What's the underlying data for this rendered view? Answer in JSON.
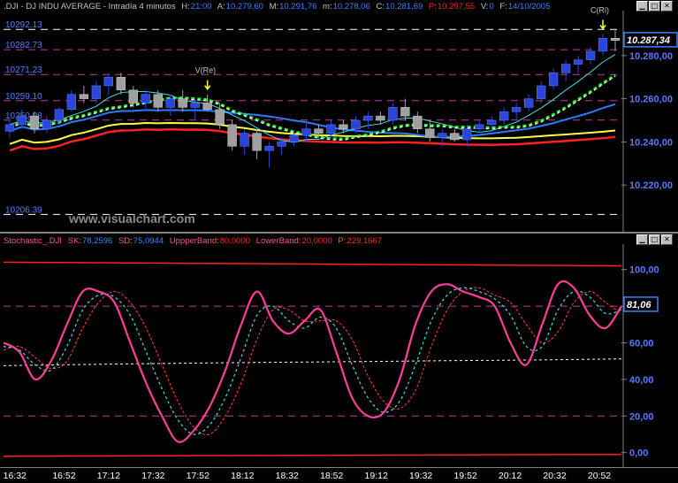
{
  "price_header": {
    "symbol": ".DJI - DJ INDU AVERAGE - Intradía 4 minutos",
    "h_label": "H:",
    "h_value": "21:00",
    "a_label": "A:",
    "a_value": "10.279,60",
    "m_label": "M:",
    "m_value": "10.291,76",
    "mi_label": "m:",
    "mi_value": "10.278,06",
    "c_label": "C:",
    "c_value": "10.281,69",
    "p_label": "P:",
    "p_value": "10.297,55",
    "v_label": "V:",
    "v_value": "0",
    "f_label": "F:",
    "f_value": "14/10/2005"
  },
  "stoch_header": {
    "name": "Stochastic_.DJI",
    "sk_label": "SK:",
    "sk_value": "78,2596",
    "sd_label": "SD:",
    "sd_value": "75,0944",
    "ub_label": "UppperBand:",
    "ub_value": "80,0000",
    "lb_label": "LowerBand:",
    "lb_value": "20,0000",
    "p_label": "P:",
    "p_value": "229,1667"
  },
  "watermark": "www.visualchart.com",
  "colors": {
    "bg": "#000000",
    "header_text": "#c0c0c0",
    "header_value": "#3f7fff",
    "p_value": "#ff2020",
    "stoch_name": "#ff5080",
    "stoch_value": "#3f7fff",
    "magenta_level": "#c03ca0",
    "up_candle": "#2a45d8",
    "down_candle": "#a0a0a0",
    "axis_text": "#5a78ff",
    "current_box": "#3f7fff",
    "stoch_k": "#ff3d9a",
    "stoch_d_cyan": "#40e0e0",
    "stoch_d_red": "#ff4040",
    "yellow": "#ffff40",
    "red_ma": "#ff2020",
    "blue_ma": "#2b7bff",
    "green_ma": "#30ff30"
  },
  "chart_data": [
    {
      "type": "candlestick",
      "title": ".DJI - DJ INDU AVERAGE - Intradía 4 minutos",
      "ylim": [
        10200,
        10300
      ],
      "y_ticks": [
        "10.280,00",
        "10.260,00",
        "10.240,00",
        "10.220,00"
      ],
      "y_tick_values": [
        10280,
        10260,
        10240,
        10220
      ],
      "current_price_label": "10.287,34",
      "current_price": 10287.34,
      "levels": [
        {
          "label": "10292.13",
          "value": 10292.13
        },
        {
          "label": "10282.73",
          "value": 10282.73
        },
        {
          "label": "10271.23",
          "value": 10271.23
        },
        {
          "label": "10259.10",
          "value": 10259.1
        },
        {
          "label": "10250.08",
          "value": 10250.08
        },
        {
          "label": "10206.39",
          "value": 10206.39
        }
      ],
      "annotations": [
        {
          "text": "V(Re)",
          "time_index": 16
        },
        {
          "text": "C(Ri)",
          "time_index": 48
        }
      ],
      "x_labels": [
        "16:32",
        "16:52",
        "17:12",
        "17:32",
        "17:52",
        "18:12",
        "18:32",
        "18:52",
        "19:12",
        "19:32",
        "19:52",
        "20:12",
        "20:32",
        "20:52"
      ],
      "candles": [
        [
          10245,
          10250,
          10242,
          10248
        ],
        [
          10248,
          10255,
          10246,
          10252
        ],
        [
          10252,
          10254,
          10244,
          10246
        ],
        [
          10246,
          10252,
          10244,
          10250
        ],
        [
          10250,
          10256,
          10248,
          10255
        ],
        [
          10255,
          10264,
          10254,
          10262
        ],
        [
          10262,
          10266,
          10258,
          10260
        ],
        [
          10260,
          10268,
          10258,
          10266
        ],
        [
          10266,
          10272,
          10262,
          10270
        ],
        [
          10270,
          10272,
          10262,
          10264
        ],
        [
          10264,
          10266,
          10256,
          10258
        ],
        [
          10258,
          10264,
          10254,
          10262
        ],
        [
          10262,
          10264,
          10254,
          10256
        ],
        [
          10256,
          10262,
          10252,
          10260
        ],
        [
          10260,
          10264,
          10254,
          10256
        ],
        [
          10256,
          10260,
          10250,
          10258
        ],
        [
          10258,
          10262,
          10254,
          10255
        ],
        [
          10255,
          10258,
          10246,
          10248
        ],
        [
          10248,
          10250,
          10236,
          10238
        ],
        [
          10238,
          10246,
          10234,
          10244
        ],
        [
          10244,
          10246,
          10232,
          10236
        ],
        [
          10236,
          10240,
          10228,
          10238
        ],
        [
          10238,
          10242,
          10234,
          10240
        ],
        [
          10240,
          10244,
          10238,
          10243
        ],
        [
          10243,
          10250,
          10240,
          10246
        ],
        [
          10246,
          10248,
          10242,
          10244
        ],
        [
          10244,
          10250,
          10242,
          10248
        ],
        [
          10248,
          10250,
          10244,
          10246
        ],
        [
          10246,
          10252,
          10244,
          10250
        ],
        [
          10250,
          10254,
          10246,
          10252
        ],
        [
          10252,
          10254,
          10248,
          10250
        ],
        [
          10250,
          10258,
          10248,
          10256
        ],
        [
          10256,
          10260,
          10250,
          10252
        ],
        [
          10252,
          10254,
          10244,
          10246
        ],
        [
          10246,
          10250,
          10240,
          10242
        ],
        [
          10242,
          10246,
          10238,
          10244
        ],
        [
          10244,
          10246,
          10240,
          10241
        ],
        [
          10241,
          10248,
          10238,
          10246
        ],
        [
          10246,
          10250,
          10244,
          10248
        ],
        [
          10248,
          10252,
          10246,
          10250
        ],
        [
          10250,
          10256,
          10248,
          10254
        ],
        [
          10254,
          10258,
          10250,
          10256
        ],
        [
          10256,
          10262,
          10254,
          10260
        ],
        [
          10260,
          10268,
          10258,
          10266
        ],
        [
          10266,
          10274,
          10264,
          10272
        ],
        [
          10272,
          10278,
          10268,
          10276
        ],
        [
          10276,
          10280,
          10272,
          10278
        ],
        [
          10278,
          10284,
          10276,
          10282
        ],
        [
          10282,
          10290,
          10280,
          10288
        ],
        [
          10288,
          10292,
          10282,
          10287
        ]
      ]
    },
    {
      "type": "line",
      "title": "Stochastic_.DJI",
      "ylim": [
        -5,
        110
      ],
      "y_ticks": [
        "100,00",
        "80,00",
        "60,00",
        "40,00",
        "20,00",
        "0,00"
      ],
      "y_tick_values": [
        100,
        80,
        60,
        40,
        20,
        0
      ],
      "current_value_label": "81,06",
      "current_value": 81.06,
      "bands": [
        80,
        20
      ],
      "x_labels": [
        "16:32",
        "16:52",
        "17:12",
        "17:32",
        "17:52",
        "18:12",
        "18:32",
        "18:52",
        "19:12",
        "19:32",
        "19:52",
        "20:12",
        "20:32",
        "20:52"
      ],
      "series": [
        {
          "name": "SK",
          "values": [
            60,
            55,
            40,
            50,
            70,
            88,
            88,
            82,
            60,
            38,
            20,
            6,
            12,
            25,
            45,
            70,
            88,
            72,
            65,
            72,
            78,
            55,
            30,
            20,
            22,
            40,
            70,
            88,
            92,
            88,
            85,
            80,
            60,
            48,
            70,
            92,
            90,
            75,
            68,
            80
          ]
        },
        {
          "name": "SD",
          "values": [
            58,
            56,
            48,
            45,
            58,
            78,
            86,
            85,
            75,
            55,
            35,
            18,
            10,
            15,
            30,
            52,
            75,
            80,
            72,
            68,
            74,
            68,
            48,
            30,
            22,
            28,
            48,
            72,
            86,
            90,
            88,
            84,
            75,
            58,
            58,
            78,
            88,
            85,
            76,
            78
          ]
        }
      ],
      "extra_lines": [
        {
          "color": "#ff4040",
          "values": [
            56,
            58,
            52,
            46,
            50,
            68,
            82,
            88,
            82,
            68,
            48,
            28,
            14,
            10,
            20,
            38,
            62,
            78,
            78,
            72,
            72,
            72,
            62,
            42,
            28,
            24,
            34,
            58,
            78,
            88,
            90,
            86,
            82,
            70,
            60,
            66,
            82,
            88,
            82,
            76
          ]
        },
        {
          "color": "#ffffff",
          "dashed": true,
          "values": [
            47.5,
            48.2,
            48.8,
            49.3,
            49.7,
            50.2,
            50.6,
            51.2
          ]
        }
      ]
    }
  ]
}
